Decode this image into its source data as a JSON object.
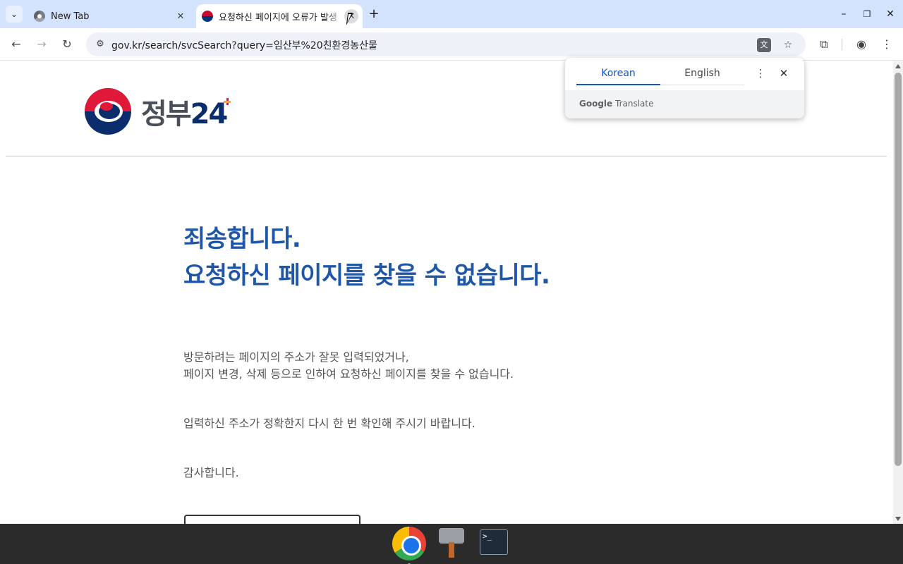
{
  "browser": {
    "tabs": [
      {
        "title": "New Tab",
        "active": false
      },
      {
        "title": "요청하신 페이지에 오류가 발생",
        "active": true
      }
    ],
    "new_tab_label": "+",
    "omnibox": {
      "host": "gov.kr",
      "path": "/search/svcSearch?query=임산부%20친환경농산물"
    }
  },
  "translate_popup": {
    "source_language": "Korean",
    "target_language": "English",
    "brand": "Google",
    "brand_product": "Translate"
  },
  "page": {
    "logo_text_prefix": "정부",
    "logo_text_number": "24",
    "headline_line1": "죄송합니다.",
    "headline_line2": "요청하신 페이지를 찾을 수 없습니다.",
    "paragraph1_line1": "방문하려는 페이지의 주소가 잘못 입력되었거나,",
    "paragraph1_line2": "페이지 변경, 삭제 등으로 인하여 요청하신 페이지를 찾을 수 없습니다.",
    "paragraph2": "입력하신 주소가 정확한지 다시 한 번 확인해 주시기 바랍니다.",
    "paragraph3": "감사합니다."
  },
  "taskbar": {
    "apps": [
      "chrome-icon",
      "tool-icon",
      "terminal-icon"
    ],
    "terminal_glyph": ">_"
  },
  "colors": {
    "headline": "#1f56a6",
    "tabstrip": "#d3e3fd",
    "translate_accent": "#0b57d0"
  }
}
